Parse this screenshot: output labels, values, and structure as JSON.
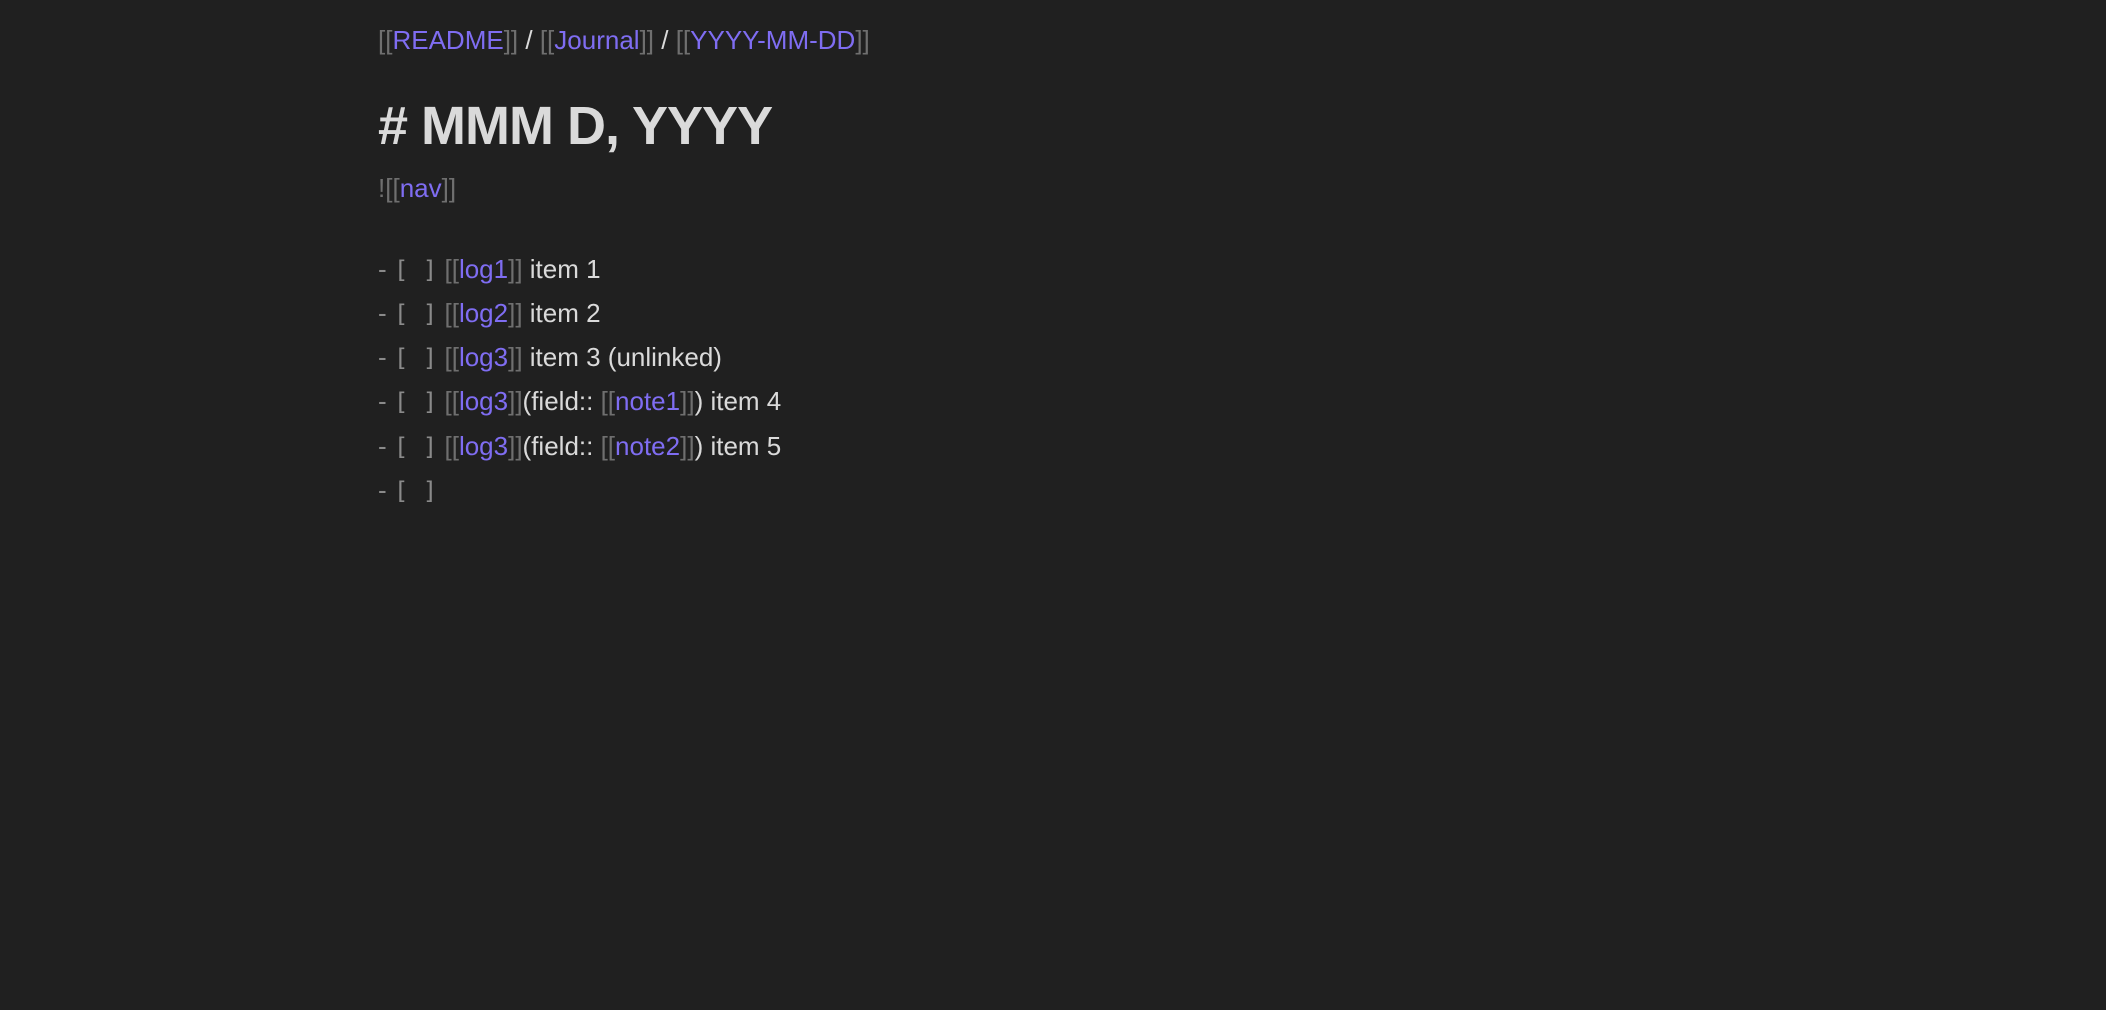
{
  "breadcrumb": {
    "open": "[[",
    "close": "]]",
    "separator": " / ",
    "items": [
      "README",
      "Journal",
      "YYYY-MM-DD"
    ]
  },
  "heading": {
    "text": "# MMM D, YYYY"
  },
  "embed": {
    "bang": "!",
    "open": "[[",
    "target": "nav",
    "close": "]]"
  },
  "tasks": {
    "dash": "- ",
    "checkbox": "[ ]",
    "items": [
      {
        "link": "log1",
        "text": " item 1"
      },
      {
        "link": "log2",
        "text": " item 2"
      },
      {
        "link": "log3",
        "text": " item 3 (unlinked)"
      },
      {
        "link": "log3",
        "field_prefix": "(field:: ",
        "field_link": "note1",
        "field_suffix": ")",
        "text": " item 4"
      },
      {
        "link": "log3",
        "field_prefix": "(field:: ",
        "field_link": "note2",
        "field_suffix": ")",
        "text": " item 5"
      }
    ]
  },
  "colors": {
    "background": "#202020",
    "text": "#dadada",
    "link": "#7f6df2",
    "bracket": "#6f6f6f"
  }
}
